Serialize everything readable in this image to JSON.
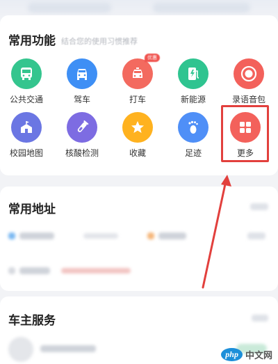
{
  "functions": {
    "title": "常用功能",
    "subtitle": "结合您的使用习惯推荐",
    "items": [
      {
        "label": "公共交通",
        "icon": "bus-icon",
        "color": "#34c58e"
      },
      {
        "label": "驾车",
        "icon": "car-icon",
        "color": "#3e8ff5"
      },
      {
        "label": "打车",
        "icon": "taxi-icon",
        "color": "#f36a5f",
        "badge": "优惠"
      },
      {
        "label": "新能源",
        "icon": "ev-charger-icon",
        "color": "#2fc490"
      },
      {
        "label": "录语音包",
        "icon": "record-icon",
        "color": "#f3615b"
      },
      {
        "label": "校园地图",
        "icon": "school-icon",
        "color": "#6b76e3"
      },
      {
        "label": "核酸检测",
        "icon": "test-tube-icon",
        "color": "#7d6ce2"
      },
      {
        "label": "收藏",
        "icon": "star-icon",
        "color": "#ffb21f"
      },
      {
        "label": "足迹",
        "icon": "footprint-icon",
        "color": "#4f8ff7"
      },
      {
        "label": "更多",
        "icon": "grid-more-icon",
        "color": "#f3615b"
      }
    ]
  },
  "address": {
    "title": "常用地址"
  },
  "car_service": {
    "title": "车主服务"
  },
  "watermark": {
    "logo": "php",
    "text": "中文网"
  },
  "colors": {
    "highlight": "#e2403d",
    "arrow": "#e2403d"
  }
}
